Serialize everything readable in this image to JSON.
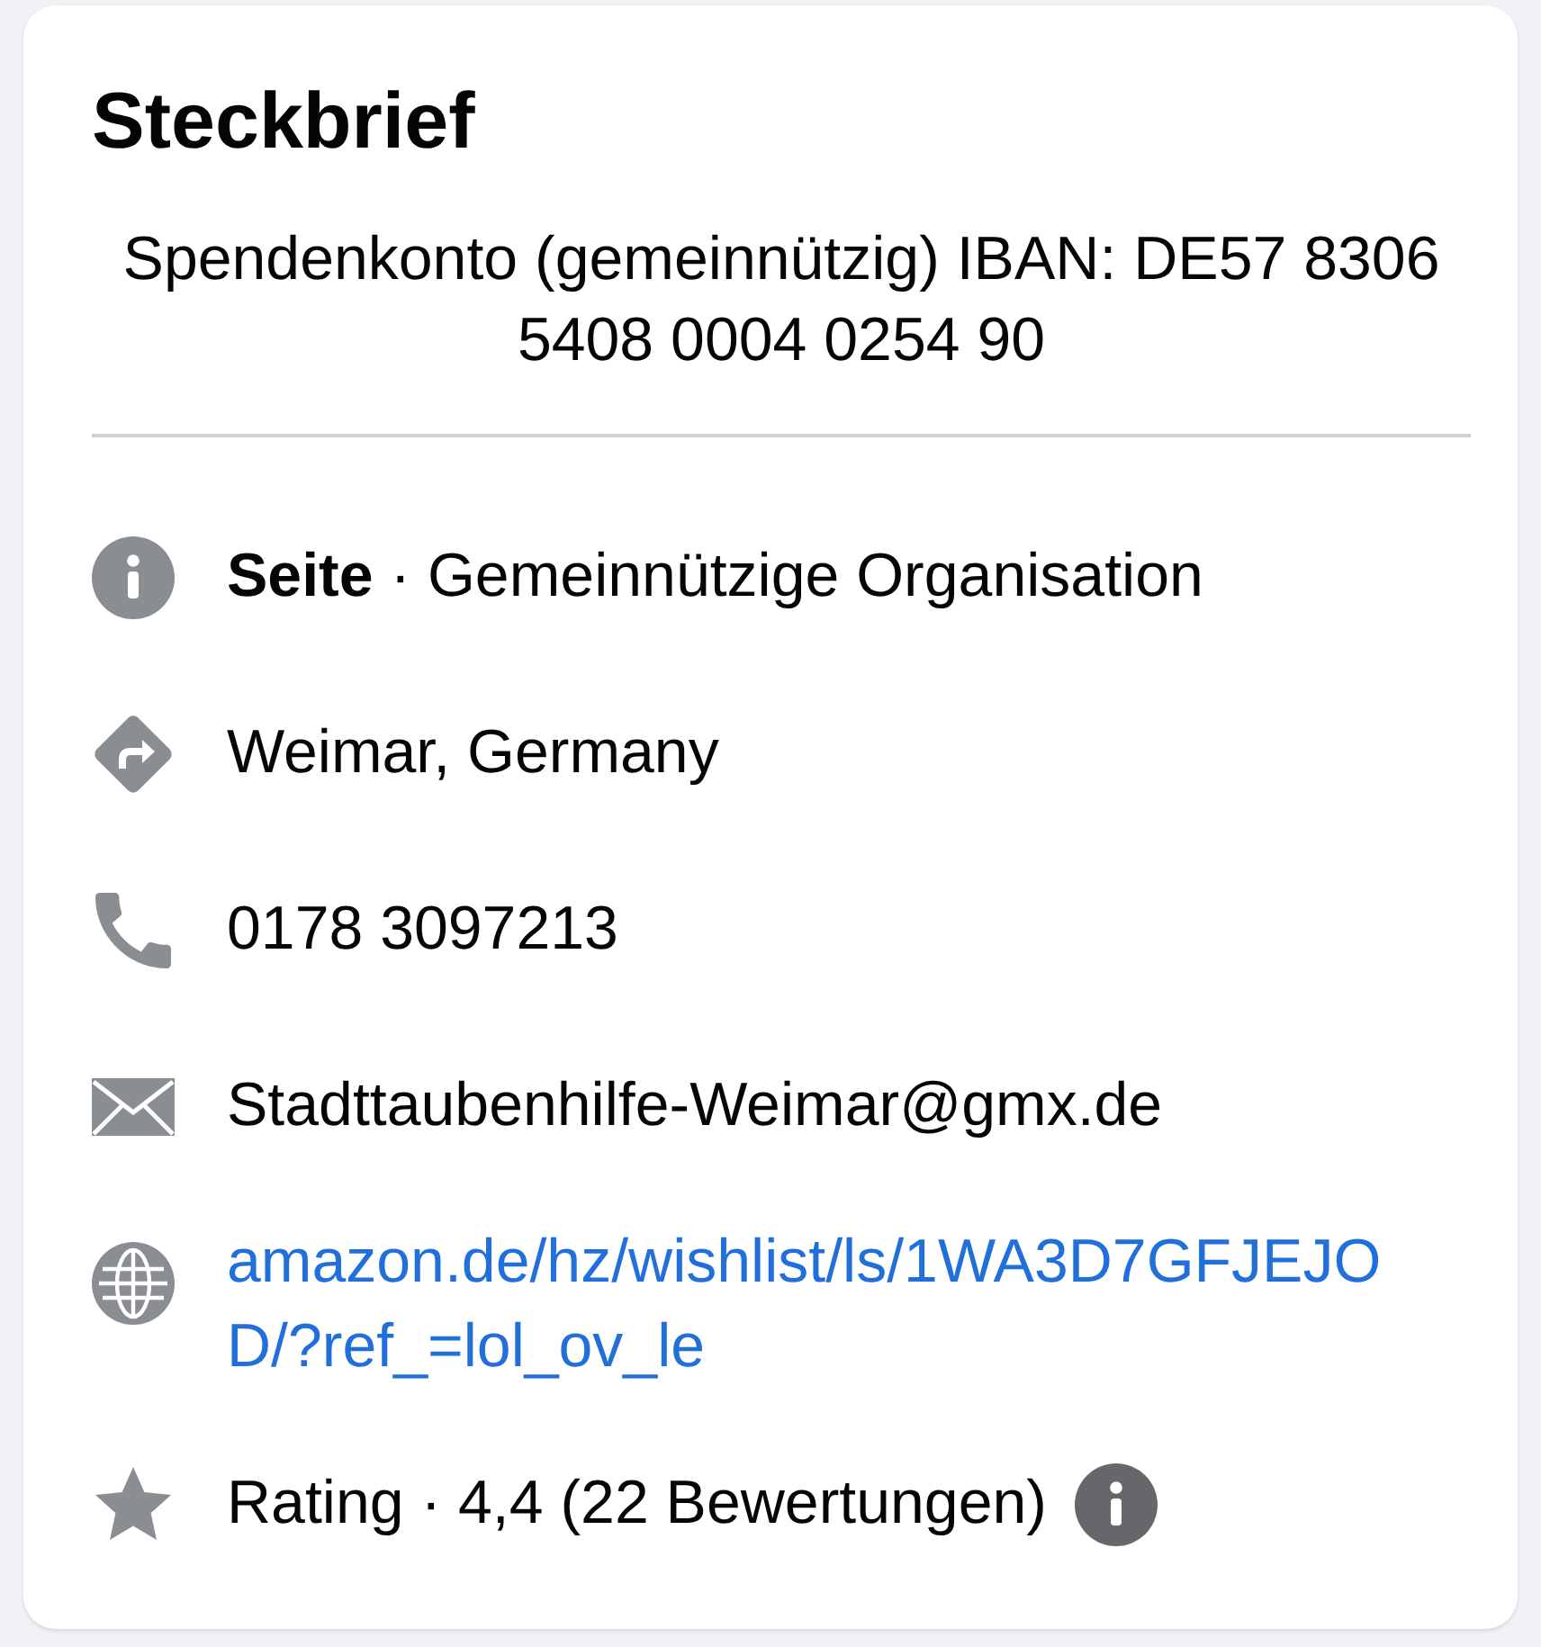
{
  "card": {
    "title": "Steckbrief",
    "description": "Spendenkonto (gemeinnützig) IBAN: DE57 8306 5408 0004 0254 90"
  },
  "details": [
    {
      "kind": "category",
      "text": "**Seite** · Gemeinnützige Organisation"
    },
    {
      "kind": "address",
      "text": "Weimar, Germany"
    },
    {
      "kind": "phone",
      "text": "0178 3097213"
    },
    {
      "kind": "email",
      "text": "Stadttaubenhilfe-Weimar@gmx.de"
    },
    {
      "kind": "website",
      "text": "amazon.de/hz/wishlist/ls/1WA3D7GFJEJOD/?ref_=lol_ov_le"
    },
    {
      "kind": "rating",
      "text": "Rating · 4,4 (22 Bewertungen)"
    }
  ]
}
